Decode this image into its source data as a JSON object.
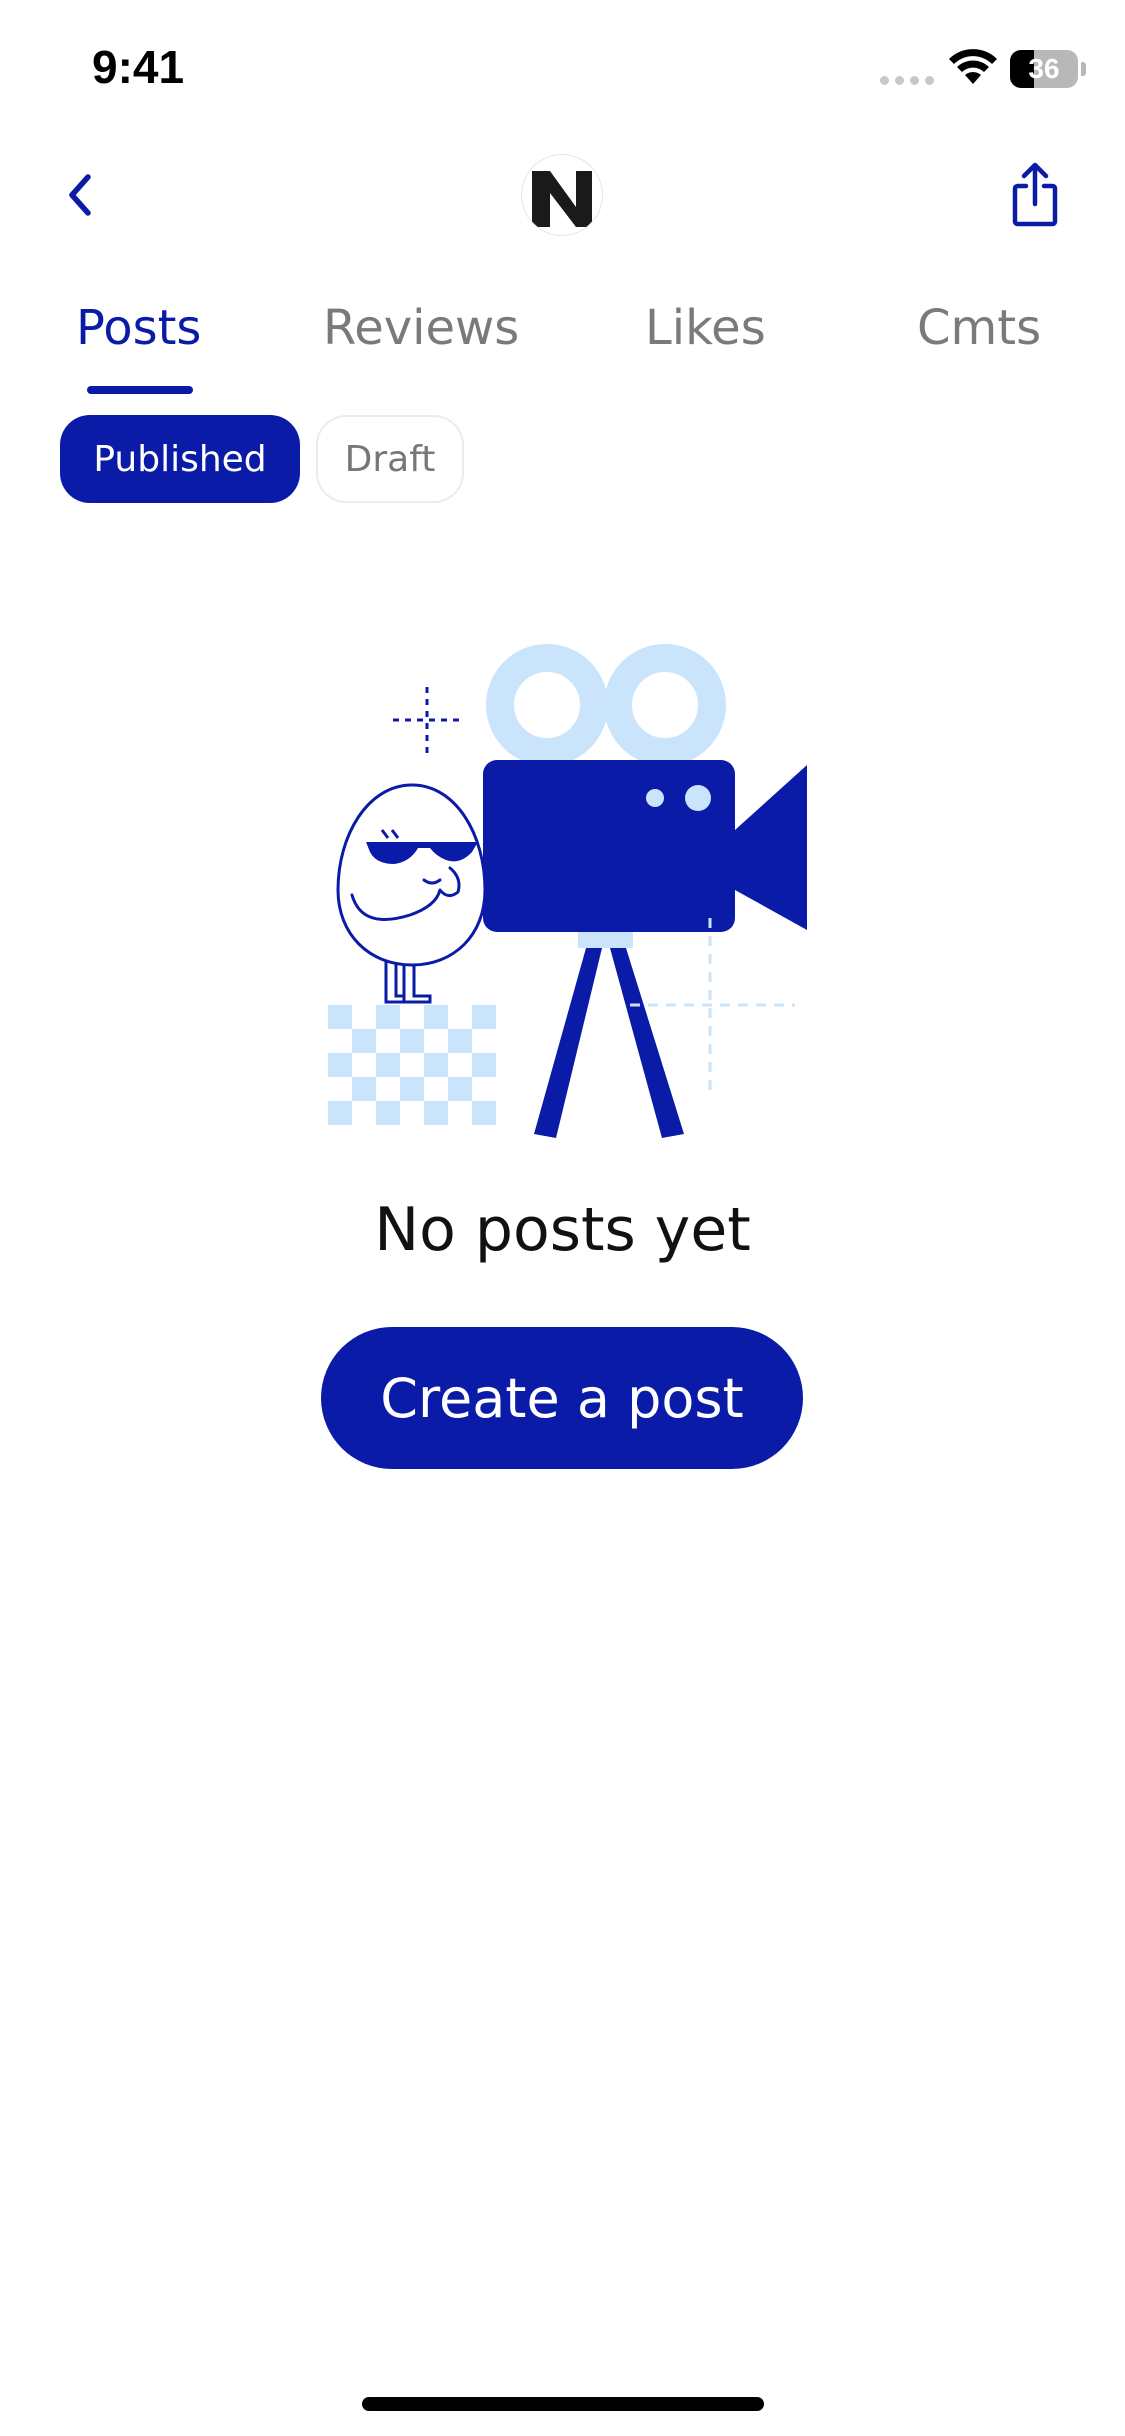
{
  "status_bar": {
    "time": "9:41",
    "battery_level": "36",
    "battery_fraction": 0.36
  },
  "nav": {
    "back_icon": "chevron-left-icon",
    "logo_letter": "N",
    "share_icon": "share-icon"
  },
  "tabs": [
    {
      "label": "Posts",
      "active": true
    },
    {
      "label": "Reviews",
      "active": false
    },
    {
      "label": "Likes",
      "active": false
    },
    {
      "label": "Cmts",
      "active": false
    }
  ],
  "filters": [
    {
      "label": "Published",
      "selected": true
    },
    {
      "label": "Draft",
      "selected": false
    }
  ],
  "empty_state": {
    "illustration": "egg-with-video-camera-illustration",
    "title": "No posts yet",
    "button_label": "Create a post"
  },
  "colors": {
    "primary": "#0A1BA8",
    "light_accent": "#C9E4FB",
    "inactive_text": "#7A7A7A"
  }
}
